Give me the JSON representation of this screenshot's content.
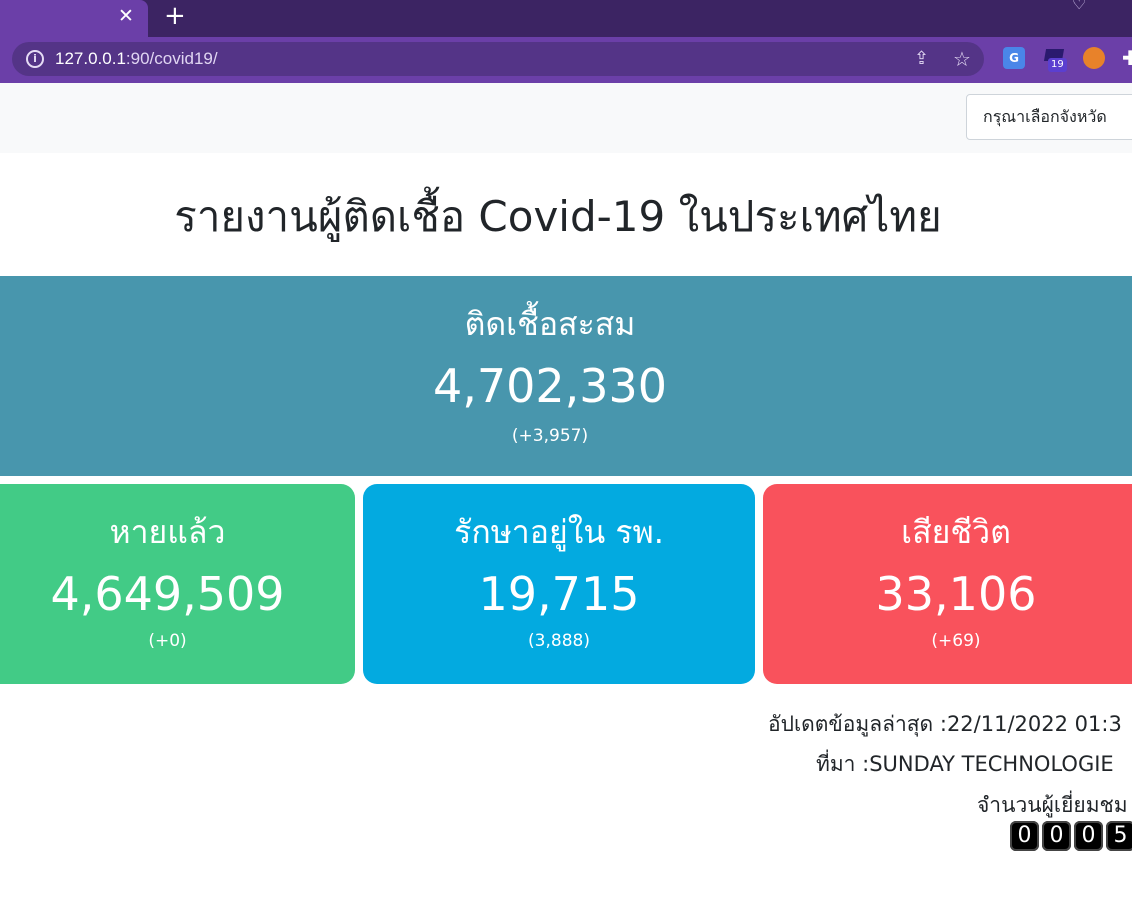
{
  "browser": {
    "url_host": "127.0.0.1",
    "url_rest": ":90/covid19/",
    "tab_close": "✕",
    "new_tab": "+",
    "extension_badge": "19"
  },
  "header": {
    "province_select": "กรุณาเลือกจังหวัด"
  },
  "title": "รายงานผู้ติดเชื้อ Covid-19 ในประเทศไทย",
  "cards": {
    "total": {
      "label": "ติดเชื้อสะสม",
      "value": "4,702,330",
      "delta": "(+3,957)",
      "color": "#4896ad"
    },
    "recovered": {
      "label": "หายแล้ว",
      "value": "4,649,509",
      "delta": "(+0)",
      "color": "#42cb86"
    },
    "hospital": {
      "label": "รักษาอยู่ใน รพ.",
      "value": "19,715",
      "delta": "(3,888)",
      "color": "#03aae0"
    },
    "deaths": {
      "label": "เสียชีวิต",
      "value": "33,106",
      "delta": "(+69)",
      "color": "#f9525c"
    }
  },
  "footer": {
    "updated": "อัปเดตข้อมูลล่าสุด :22/11/2022 01:3",
    "source": "ที่มา :SUNDAY TECHNOLOGIE",
    "visitors_label": "จำนวนผู้เยี่ยมชม",
    "counter_digits": [
      "0",
      "0",
      "0",
      "5"
    ]
  },
  "icons": {
    "info": "info-icon",
    "share": "share-icon",
    "star": "star-icon",
    "translate": "google-translate-icon",
    "cap": "graduation-cap-icon",
    "fox": "metamask-fox-icon",
    "puzzle": "extensions-puzzle-icon"
  }
}
